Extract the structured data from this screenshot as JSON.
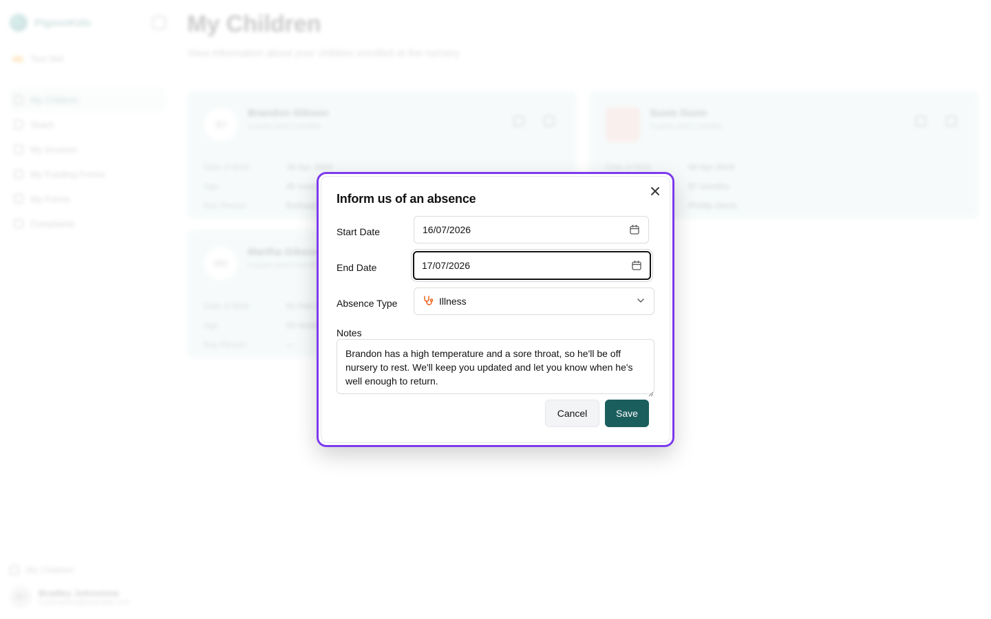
{
  "sidebar": {
    "brand": "PigeonKids",
    "top_item": "Test Mel",
    "items": [
      {
        "label": "My Children"
      },
      {
        "label": "Teach"
      },
      {
        "label": "My Invoices"
      },
      {
        "label": "My Funding Forms"
      },
      {
        "label": "My Forms"
      },
      {
        "label": "Complaints"
      }
    ],
    "bottom_item": "My Children",
    "user": {
      "initials": "BJ",
      "name": "Bradley Johnstone",
      "email": "b.johnstone@example.com"
    }
  },
  "main": {
    "title": "My Children",
    "subtitle": "View information about your children enrolled at the nursery",
    "cards": [
      {
        "initials": "BJ",
        "name": "Brandon Gibson",
        "age": "2 years and 3 months",
        "rows": [
          [
            "Date of Birth",
            "16 Apr 2023"
          ],
          [
            "Age",
            "40 months"
          ],
          [
            "Key Person",
            "Bethany"
          ]
        ]
      },
      {
        "initials": "",
        "name": "Susie Gunn",
        "age": "3 years and 1 months",
        "rows": [
          [
            "Date of Birth",
            "04 Apr 2019"
          ],
          [
            "Age",
            "87 months"
          ],
          [
            "Key Person",
            "Phillip Davis"
          ]
        ]
      },
      {
        "initials": "MG",
        "name": "Martha Gibson",
        "age": "4 years and 2 months",
        "rows": [
          [
            "Date of Birth",
            "01 Feb 2022"
          ],
          [
            "Age",
            "53 months"
          ],
          [
            "Key Person",
            "—"
          ]
        ]
      }
    ]
  },
  "modal": {
    "title": "Inform us of an absence",
    "start_label": "Start Date",
    "start_value": "16/07/2026",
    "end_label": "End Date",
    "end_value": "17/07/2026",
    "type_label": "Absence Type",
    "type_value": "Illness",
    "notes_label": "Notes",
    "notes_value": "Brandon has a high temperature and a sore throat, so he'll be off nursery to rest. We'll keep you updated and let you know when he's well enough to return.",
    "cancel_label": "Cancel",
    "save_label": "Save"
  },
  "colors": {
    "accent": "#1b5e5e",
    "focus_ring": "#7c3aed",
    "illness_icon": "#ea580c"
  }
}
